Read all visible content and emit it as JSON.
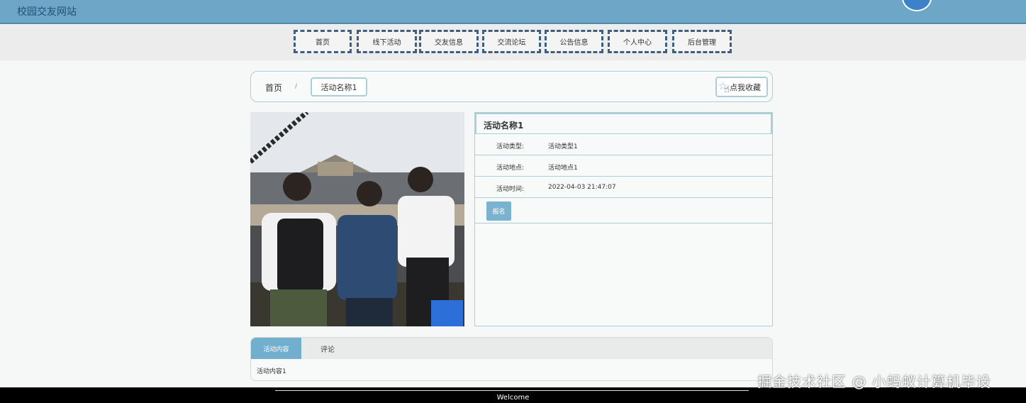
{
  "header": {
    "site_title": "校园交友网站"
  },
  "nav": {
    "items": [
      "首页",
      "线下活动",
      "交友信息",
      "交流论坛",
      "公告信息",
      "个人中心",
      "后台管理"
    ]
  },
  "breadcrumb": {
    "home": "首页",
    "separator": "/",
    "current": "活动名称1"
  },
  "favorite": {
    "label": "点我收藏"
  },
  "activity": {
    "name": "活动名称1",
    "fields": [
      {
        "label": "活动类型:",
        "value": "活动类型1"
      },
      {
        "label": "活动地点:",
        "value": "活动地点1"
      },
      {
        "label": "活动时间:",
        "value": "2022-04-03 21:47:07"
      }
    ],
    "signup_label": "报名"
  },
  "tabs": {
    "items": [
      "活动内容",
      "评论"
    ],
    "content": "活动内容1"
  },
  "footer": {
    "text": "Welcome"
  },
  "watermark": "掘金技术社区 @ 小蚂蚁计算机毕设",
  "colors": {
    "header": "#6ea6c8",
    "accent": "#72aece",
    "border": "#a9d0d8"
  }
}
